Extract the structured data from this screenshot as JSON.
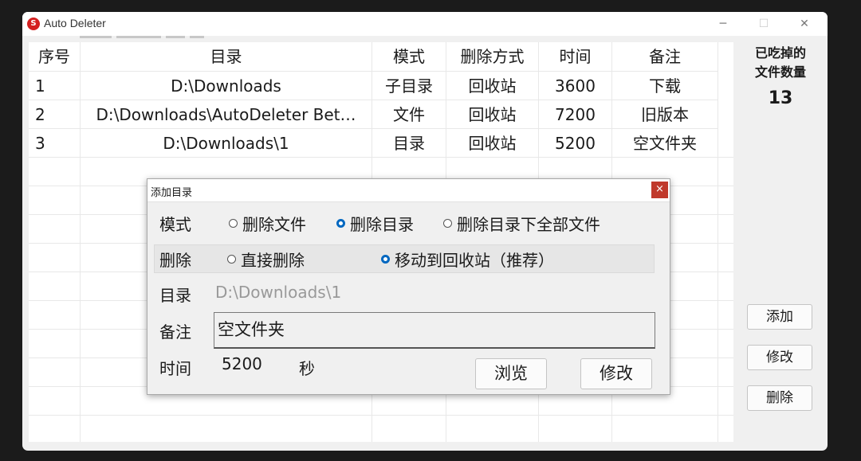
{
  "window": {
    "title": "Auto Deleter",
    "minimize": "─",
    "maximize": "☐",
    "close": "✕"
  },
  "table": {
    "headers": [
      "序号",
      "目录",
      "模式",
      "删除方式",
      "时间",
      "备注"
    ],
    "rows": [
      [
        "1",
        "D:\\Downloads",
        "子目录",
        "回收站",
        "3600",
        "下载"
      ],
      [
        "2",
        "D:\\Downloads\\AutoDeleter Bet…",
        "文件",
        "回收站",
        "7200",
        "旧版本"
      ],
      [
        "3",
        "D:\\Downloads\\1",
        "目录",
        "回收站",
        "5200",
        "空文件夹"
      ]
    ]
  },
  "sidebar": {
    "count_title_line1": "已吃掉的",
    "count_title_line2": "文件数量",
    "count": "13",
    "add": "添加",
    "edit": "修改",
    "delete": "删除"
  },
  "dialog": {
    "title": "添加目录",
    "close": "×",
    "mode_label": "模式",
    "mode_options": [
      "删除文件",
      "删除目录",
      "删除目录下全部文件"
    ],
    "mode_selected": 1,
    "delete_label": "删除",
    "delete_options": [
      "直接删除",
      "移动到回收站（推荐）"
    ],
    "delete_selected": 1,
    "dir_label": "目录",
    "dir_value": "D:\\Downloads\\1",
    "note_label": "备注",
    "note_value": "空文件夹",
    "time_label": "时间",
    "time_value": "5200",
    "time_unit": "秒",
    "browse": "浏览",
    "modify": "修改"
  }
}
